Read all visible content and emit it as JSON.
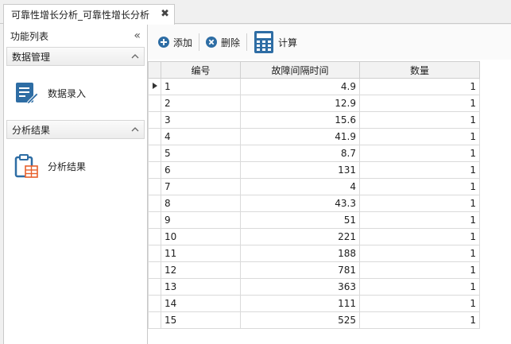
{
  "tab": {
    "title": "可靠性增长分析_可靠性增长分析",
    "close_glyph": "✖"
  },
  "nav": {
    "title": "功能列表",
    "collapse_glyph": "«",
    "groups": [
      {
        "title": "数据管理",
        "items": [
          {
            "label": "数据录入",
            "icon": "data-entry-icon"
          }
        ]
      },
      {
        "title": "分析结果",
        "items": [
          {
            "label": "分析结果",
            "icon": "clipboard-table-icon"
          }
        ]
      }
    ]
  },
  "toolbar": {
    "add_label": "添加",
    "delete_label": "删除",
    "calc_label": "计算"
  },
  "grid": {
    "columns": [
      "编号",
      "故障间隔时间",
      "数量"
    ],
    "rows": [
      [
        "1",
        "4.9",
        "1"
      ],
      [
        "2",
        "12.9",
        "1"
      ],
      [
        "3",
        "15.6",
        "1"
      ],
      [
        "4",
        "41.9",
        "1"
      ],
      [
        "5",
        "8.7",
        "1"
      ],
      [
        "6",
        "131",
        "1"
      ],
      [
        "7",
        "4",
        "1"
      ],
      [
        "8",
        "43.3",
        "1"
      ],
      [
        "9",
        "51",
        "1"
      ],
      [
        "10",
        "221",
        "1"
      ],
      [
        "11",
        "188",
        "1"
      ],
      [
        "12",
        "781",
        "1"
      ],
      [
        "13",
        "363",
        "1"
      ],
      [
        "14",
        "111",
        "1"
      ],
      [
        "15",
        "525",
        "1"
      ]
    ]
  },
  "colors": {
    "accent_blue": "#2e6da4",
    "accent_orange": "#e8602c"
  }
}
